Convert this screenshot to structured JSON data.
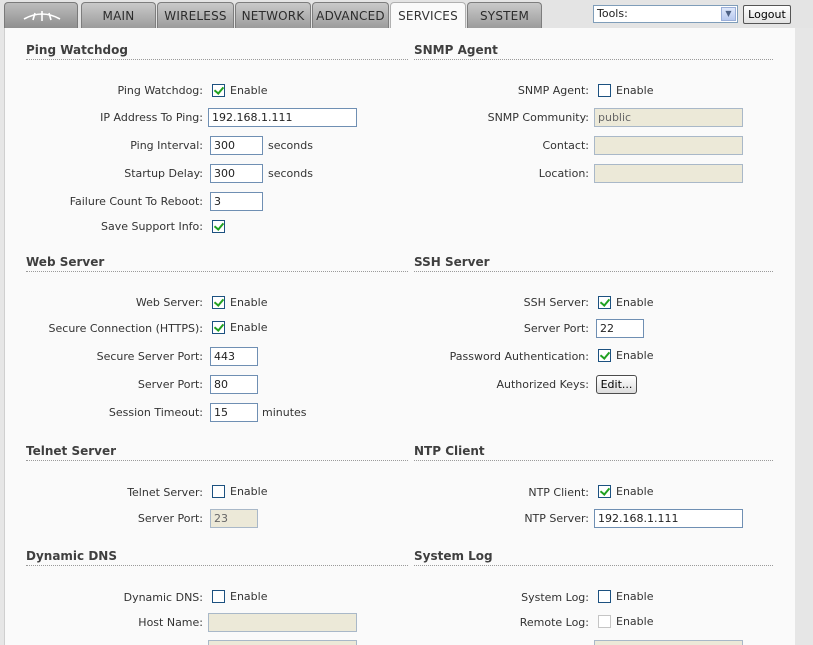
{
  "tabs": [
    {
      "label": "MAIN"
    },
    {
      "label": "WIRELESS"
    },
    {
      "label": "NETWORK"
    },
    {
      "label": "ADVANCED"
    },
    {
      "label": "SERVICES",
      "active": true
    },
    {
      "label": "SYSTEM"
    }
  ],
  "logo_icon": "ubiquiti-logo-icon",
  "tools": {
    "value": "Tools:"
  },
  "logout_label": "Logout",
  "enable": "Enable",
  "ping": {
    "title": "Ping Watchdog",
    "watchdog_label": "Ping Watchdog:",
    "watchdog_enabled": true,
    "ip_label": "IP Address To Ping:",
    "ip_value": "192.168.1.111",
    "interval_label": "Ping Interval:",
    "interval_value": "300",
    "interval_unit": "seconds",
    "startup_label": "Startup Delay:",
    "startup_value": "300",
    "startup_unit": "seconds",
    "failure_label": "Failure Count To Reboot:",
    "failure_value": "3",
    "support_label": "Save Support Info:",
    "support_checked": true
  },
  "snmp": {
    "title": "SNMP Agent",
    "agent_label": "SNMP Agent:",
    "agent_enabled": false,
    "community_label": "SNMP Community:",
    "community_value": "public",
    "contact_label": "Contact:",
    "contact_value": "",
    "location_label": "Location:",
    "location_value": ""
  },
  "web": {
    "title": "Web Server",
    "server_label": "Web Server:",
    "server_enabled": true,
    "https_label": "Secure Connection (HTTPS):",
    "https_enabled": true,
    "secure_port_label": "Secure Server Port:",
    "secure_port_value": "443",
    "port_label": "Server Port:",
    "port_value": "80",
    "timeout_label": "Session Timeout:",
    "timeout_value": "15",
    "timeout_unit": "minutes"
  },
  "ssh": {
    "title": "SSH Server",
    "server_label": "SSH Server:",
    "server_enabled": true,
    "port_label": "Server Port:",
    "port_value": "22",
    "password_label": "Password Authentication:",
    "password_enabled": true,
    "keys_label": "Authorized Keys:",
    "keys_button": "Edit..."
  },
  "telnet": {
    "title": "Telnet Server",
    "server_label": "Telnet Server:",
    "server_enabled": false,
    "port_label": "Server Port:",
    "port_value": "23"
  },
  "ntp": {
    "title": "NTP Client",
    "client_label": "NTP Client:",
    "client_enabled": true,
    "server_label": "NTP Server:",
    "server_value": "192.168.1.111"
  },
  "ddns": {
    "title": "Dynamic DNS",
    "ddns_label": "Dynamic DNS:",
    "ddns_enabled": false,
    "host_label": "Host Name:",
    "host_value": ""
  },
  "syslog": {
    "title": "System Log",
    "log_label": "System Log:",
    "log_enabled": false,
    "remote_label": "Remote Log:",
    "remote_enabled": false
  },
  "colors": {
    "check": "#21a121",
    "active_tab": "#fafafa",
    "tab": "#a9a9a9"
  }
}
